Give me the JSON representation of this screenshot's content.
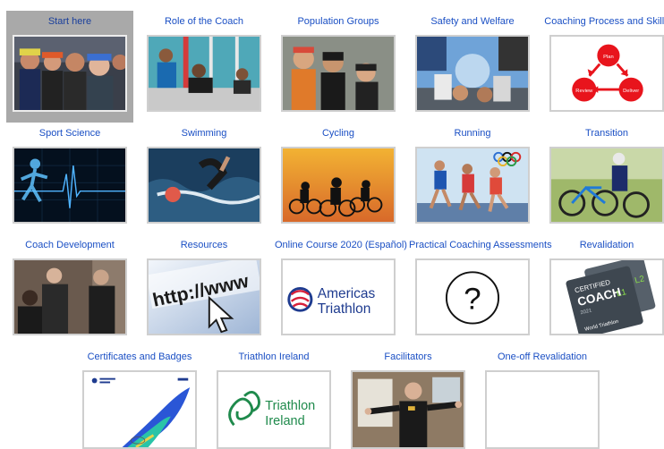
{
  "tiles": [
    {
      "label": "Start here",
      "icon": "athletes-photo",
      "active": true
    },
    {
      "label": "Role of the Coach",
      "icon": "pool-coaching-photo"
    },
    {
      "label": "Population Groups",
      "icon": "young-athletes-photo"
    },
    {
      "label": "Safety and Welfare",
      "icon": "athletes-huddle-photo"
    },
    {
      "label": "Coaching Process and Skills",
      "icon": "plan-review-deliver-diagram",
      "diagram": {
        "plan": "Plan",
        "review": "Review",
        "deliver": "Deliver"
      }
    },
    {
      "label": "Sport Science",
      "icon": "runner-heartbeat-graphic"
    },
    {
      "label": "Swimming",
      "icon": "swimmer-photo"
    },
    {
      "label": "Cycling",
      "icon": "cyclists-sunset-photo"
    },
    {
      "label": "Running",
      "icon": "runners-race-photo"
    },
    {
      "label": "Transition",
      "icon": "transition-bike-photo"
    },
    {
      "label": "Coach Development",
      "icon": "coach-group-photo"
    },
    {
      "label": "Resources",
      "icon": "http-cursor-graphic",
      "graphic_text": "http://www"
    },
    {
      "label": "Online Course 2020 (Español)",
      "icon": "americas-triathlon-logo",
      "logo_text": {
        "line1": "Americas",
        "line2": "Triathlon"
      }
    },
    {
      "label": "Practical Coaching Assessments",
      "icon": "question-mark-icon",
      "glyph": "?"
    },
    {
      "label": "Revalidation",
      "icon": "certified-coach-badge",
      "badge_text": {
        "top": "CERTIFIED",
        "main": "COACH",
        "level1": "L1",
        "level2": "L2",
        "org": "World Triathlon",
        "year": "2021"
      }
    },
    {
      "label": "Certificates and Badges",
      "icon": "certificate-document"
    },
    {
      "label": "Triathlon Ireland",
      "icon": "triathlon-ireland-logo",
      "logo_text": {
        "line1": "Triathlon",
        "line2": "Ireland"
      }
    },
    {
      "label": "Facilitators",
      "icon": "facilitator-photo"
    },
    {
      "label": "One-off Revalidation",
      "icon": "blank-image"
    }
  ],
  "colors": {
    "label": "#1a4fc4",
    "active_bg": "#a9a9a9",
    "plan_red": "#e8141c",
    "ireland_green": "#1f8a4c",
    "americas_blue": "#1e3b8f"
  }
}
